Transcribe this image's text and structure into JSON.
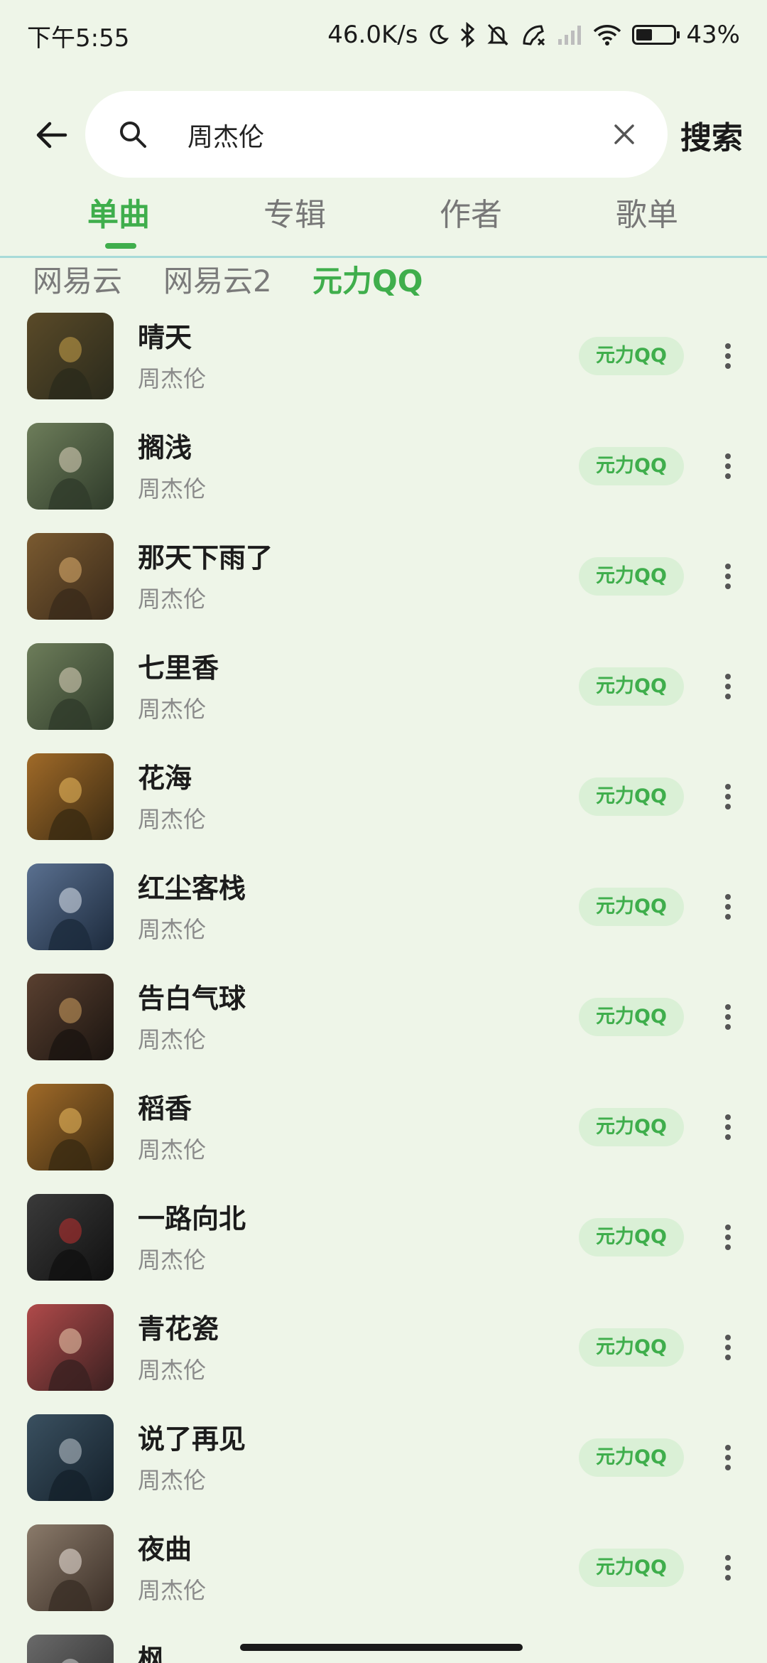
{
  "status_bar": {
    "time": "下午5:55",
    "network_speed": "46.0K/s",
    "battery": "43%",
    "battery_level": 0.43,
    "icons": [
      "moon-icon",
      "bluetooth-icon",
      "mute-bell-icon",
      "call-icon",
      "signal-icon",
      "wifi-icon",
      "battery-icon"
    ]
  },
  "search": {
    "query": "周杰伦",
    "submit_label": "搜索"
  },
  "tabs": [
    {
      "label": "单曲",
      "active": true
    },
    {
      "label": "专辑",
      "active": false
    },
    {
      "label": "作者",
      "active": false
    },
    {
      "label": "歌单",
      "active": false
    }
  ],
  "sources": [
    {
      "label": "网易云",
      "active": false
    },
    {
      "label": "网易云2",
      "active": false
    },
    {
      "label": "元力QQ",
      "active": true
    }
  ],
  "songs": [
    {
      "title": "晴天",
      "artist": "周杰伦",
      "source": "元力QQ"
    },
    {
      "title": "搁浅",
      "artist": "周杰伦",
      "source": "元力QQ"
    },
    {
      "title": "那天下雨了",
      "artist": "周杰伦",
      "source": "元力QQ"
    },
    {
      "title": "七里香",
      "artist": "周杰伦",
      "source": "元力QQ"
    },
    {
      "title": "花海",
      "artist": "周杰伦",
      "source": "元力QQ"
    },
    {
      "title": "红尘客栈",
      "artist": "周杰伦",
      "source": "元力QQ"
    },
    {
      "title": "告白气球",
      "artist": "周杰伦",
      "source": "元力QQ"
    },
    {
      "title": "稻香",
      "artist": "周杰伦",
      "source": "元力QQ"
    },
    {
      "title": "一路向北",
      "artist": "周杰伦",
      "source": "元力QQ"
    },
    {
      "title": "青花瓷",
      "artist": "周杰伦",
      "source": "元力QQ"
    },
    {
      "title": "说了再见",
      "artist": "周杰伦",
      "source": "元力QQ"
    },
    {
      "title": "夜曲",
      "artist": "周杰伦",
      "source": "元力QQ"
    },
    {
      "title": "枫",
      "artist": "",
      "source": ""
    }
  ],
  "colors": {
    "accent": "#3fae4c",
    "background": "#eef5e8",
    "badge_bg": "#daf0d6"
  }
}
